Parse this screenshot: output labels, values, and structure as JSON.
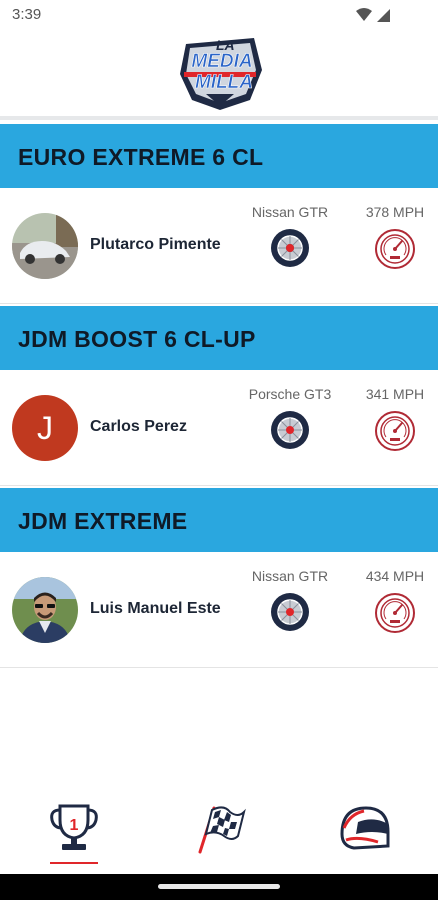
{
  "status_bar": {
    "time": "3:39",
    "icons": [
      "wifi-icon",
      "signal-icon"
    ]
  },
  "header": {
    "logo_lines": [
      "LA",
      "MEDIA",
      "MILLA"
    ]
  },
  "sections": [
    {
      "title": "EURO EXTREME 6 CL",
      "driver": "Plutarco Pimente",
      "avatar": "photo",
      "car": "Nissan GTR",
      "speed": "378 MPH"
    },
    {
      "title": "JDM BOOST 6 CL-UP",
      "driver": "Carlos Perez",
      "avatar": "initial",
      "avatar_initial": "J",
      "car": "Porsche GT3",
      "speed": "341 MPH"
    },
    {
      "title": "JDM EXTREME",
      "driver": "Luis Manuel Este",
      "avatar": "photo",
      "car": "Nissan GTR",
      "speed": "434 MPH"
    }
  ],
  "bottom_nav": [
    {
      "name": "trophy-icon",
      "selected": true
    },
    {
      "name": "checkered-flag-icon",
      "selected": false
    },
    {
      "name": "helmet-icon",
      "selected": false
    }
  ],
  "colors": {
    "section_header": "#2aa7df",
    "avatar_initial_bg": "#c0391f",
    "accent_red": "#e0262a",
    "icon_navy": "#1f2a44"
  }
}
